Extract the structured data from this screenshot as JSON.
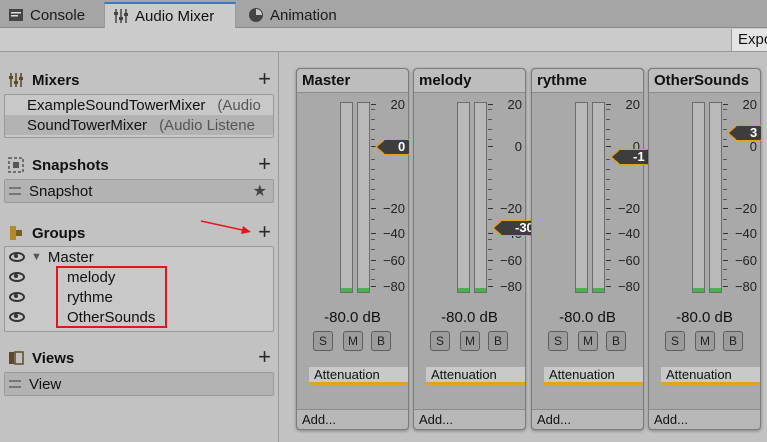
{
  "tabs": [
    {
      "label": "Console",
      "icon": "console-icon"
    },
    {
      "label": "Audio Mixer",
      "icon": "mixer-icon"
    },
    {
      "label": "Animation",
      "icon": "animation-icon"
    }
  ],
  "toolbar": {
    "export_label": "Expo"
  },
  "mixers": {
    "title": "Mixers",
    "items": [
      {
        "name": "ExampleSoundTowerMixer",
        "sub": "(Audio"
      },
      {
        "name": "SoundTowerMixer",
        "sub": "(Audio Listene"
      }
    ]
  },
  "snapshots": {
    "title": "Snapshots",
    "items": [
      {
        "name": "Snapshot"
      }
    ]
  },
  "groups": {
    "title": "Groups",
    "root": "Master",
    "children": [
      "melody",
      "rythme",
      "OtherSounds"
    ]
  },
  "views": {
    "title": "Views",
    "items": [
      {
        "name": "View"
      }
    ]
  },
  "strips": [
    {
      "name": "Master",
      "fader": "0",
      "level_db": "-80.0 dB"
    },
    {
      "name": "melody",
      "fader": "-30",
      "level_db": "-80.0 dB"
    },
    {
      "name": "rythme",
      "fader": "-1",
      "level_db": "-80.0 dB"
    },
    {
      "name": "OtherSounds",
      "fader": "3",
      "level_db": "-80.0 dB"
    }
  ],
  "scale_labels": [
    "20",
    "0",
    "−20",
    "−40",
    "−60",
    "−80"
  ],
  "strip_buttons": [
    "S",
    "M",
    "B"
  ],
  "effect_label": "Attenuation",
  "add_label": "Add...",
  "colors": {
    "accent": "#e2a11e",
    "annotation": "#e8141c",
    "tab_active": "#3a79bb"
  }
}
